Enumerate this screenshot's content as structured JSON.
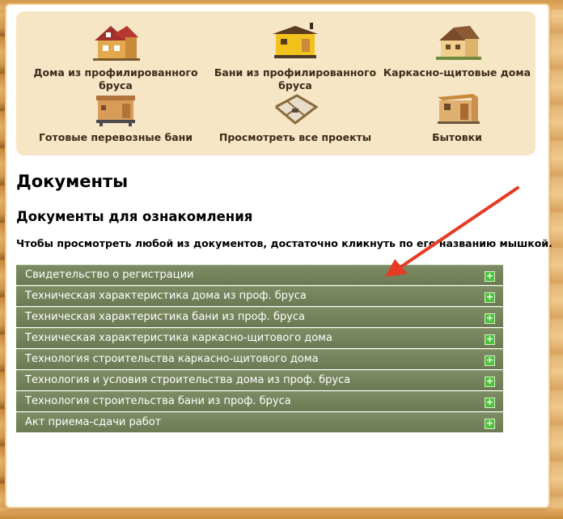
{
  "menu": {
    "items": [
      {
        "label": "Дома из профилированного бруса",
        "icon": "two-storey-house-icon"
      },
      {
        "label": "Бани из профилированного бруса",
        "icon": "bath-house-icon"
      },
      {
        "label": "Каркасно-щитовые дома",
        "icon": "frame-house-icon"
      },
      {
        "label": "Готовые перевозные бани",
        "icon": "mobile-bath-icon"
      },
      {
        "label": "Просмотреть все проекты",
        "icon": "floor-plan-icon"
      },
      {
        "label": "Бытовки",
        "icon": "cabin-icon"
      }
    ]
  },
  "page": {
    "title": "Документы",
    "subtitle": "Документы для ознакомления",
    "intro": "Чтобы просмотреть любой из документов, достаточно кликнуть по его названию мышкой."
  },
  "documents": [
    {
      "label": "Свидетельство о регистрации"
    },
    {
      "label": "Техническая характеристика дома из проф. бруса"
    },
    {
      "label": "Техническая характеристика бани из проф. бруса"
    },
    {
      "label": "Техническая характеристика каркасно-щитового дома"
    },
    {
      "label": "Технология строительства каркасно-щитового дома"
    },
    {
      "label": "Технология и условия строительства дома из проф. бруса"
    },
    {
      "label": "Технология строительства бани из проф. бруса"
    },
    {
      "label": "Акт приема-сдачи работ"
    }
  ],
  "colors": {
    "menu_bg": "#f6e6c6",
    "row_bg": "#75835c",
    "plus": "#4ec23a",
    "arrow": "#e53a25"
  }
}
